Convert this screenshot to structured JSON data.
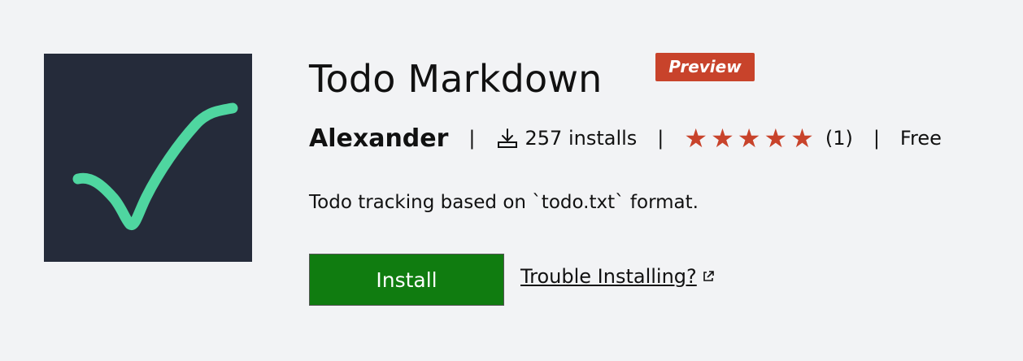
{
  "extension": {
    "title": "Todo Markdown",
    "badge": "Preview",
    "author": "Alexander",
    "separator": "|",
    "installs": "257 installs",
    "rating": {
      "stars": 5,
      "count": "(1)"
    },
    "price": "Free",
    "description": "Todo tracking based on `todo.txt` format.",
    "install_label": "Install",
    "trouble_label": "Trouble Installing?"
  },
  "icons": {
    "logo": "checkmark-logo",
    "installs": "download-icon",
    "star": "star-icon",
    "external": "external-link-icon"
  },
  "colors": {
    "background": "#f2f3f5",
    "logo_bg": "#252b3a",
    "checkmark": "#4fd6a0",
    "badge": "#c8432b",
    "star": "#c8432b",
    "install_button": "#107c10"
  }
}
